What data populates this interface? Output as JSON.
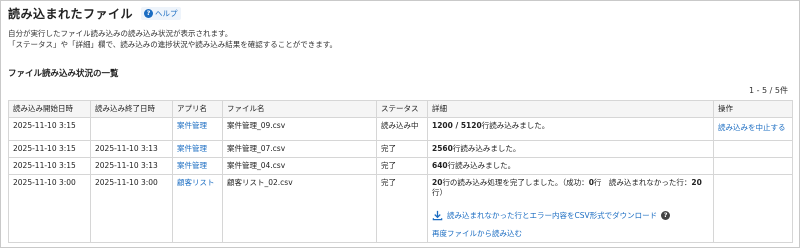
{
  "header": {
    "title": "読み込まれたファイル",
    "help_label": "ヘルプ",
    "help_icon": "question-circle-icon"
  },
  "description": {
    "line1": "自分が実行したファイル読み込みの読み込み状況が表示されます。",
    "line2": "「ステータス」や「詳細」欄で、読み込みの進捗状況や読み込み結果を確認することができます。"
  },
  "section": {
    "title": "ファイル読み込み状況の一覧",
    "pager": "1 - 5 / 5件"
  },
  "table": {
    "columns": [
      "読み込み開始日時",
      "読み込み終了日時",
      "アプリ名",
      "ファイル名",
      "ステータス",
      "詳細",
      "操作"
    ],
    "rows": [
      {
        "start": "2025-11-10 3:15",
        "end": "",
        "app": "案件管理",
        "file": "案件管理_09.csv",
        "status": "読み込み中",
        "detail_bold": "1200 / 5120",
        "detail_rest": "行読み込みました。",
        "action": "読み込みを中止する"
      },
      {
        "start": "2025-11-10 3:15",
        "end": "2025-11-10 3:13",
        "app": "案件管理",
        "file": "案件管理_07.csv",
        "status": "完了",
        "detail_bold": "2560",
        "detail_rest": "行読み込みました。",
        "action": ""
      },
      {
        "start": "2025-11-10 3:15",
        "end": "2025-11-10 3:13",
        "app": "案件管理",
        "file": "案件管理_04.csv",
        "status": "完了",
        "detail_bold": "640",
        "detail_rest": "行読み込みました。",
        "action": ""
      },
      {
        "start": "2025-11-10 3:00",
        "end": "2025-11-10 3:00",
        "app": "顧客リスト",
        "file": "顧客リスト_02.csv",
        "status": "完了",
        "detail_bold": "20",
        "detail_rest": "行の読み込み処理を完了しました。（成功：",
        "detail_success": "0",
        "detail_mid": "行　読み込まれなかった行：",
        "detail_failed": "20",
        "detail_end": "行）",
        "download_label": "読み込まれなかった行とエラー内容をCSV形式でダウンロード",
        "reload_label": "再度ファイルから読み込む",
        "action": ""
      }
    ]
  },
  "colors": {
    "link": "#1a6cc2",
    "header_bg": "#f5f5f5",
    "border": "#d6d6d6"
  }
}
